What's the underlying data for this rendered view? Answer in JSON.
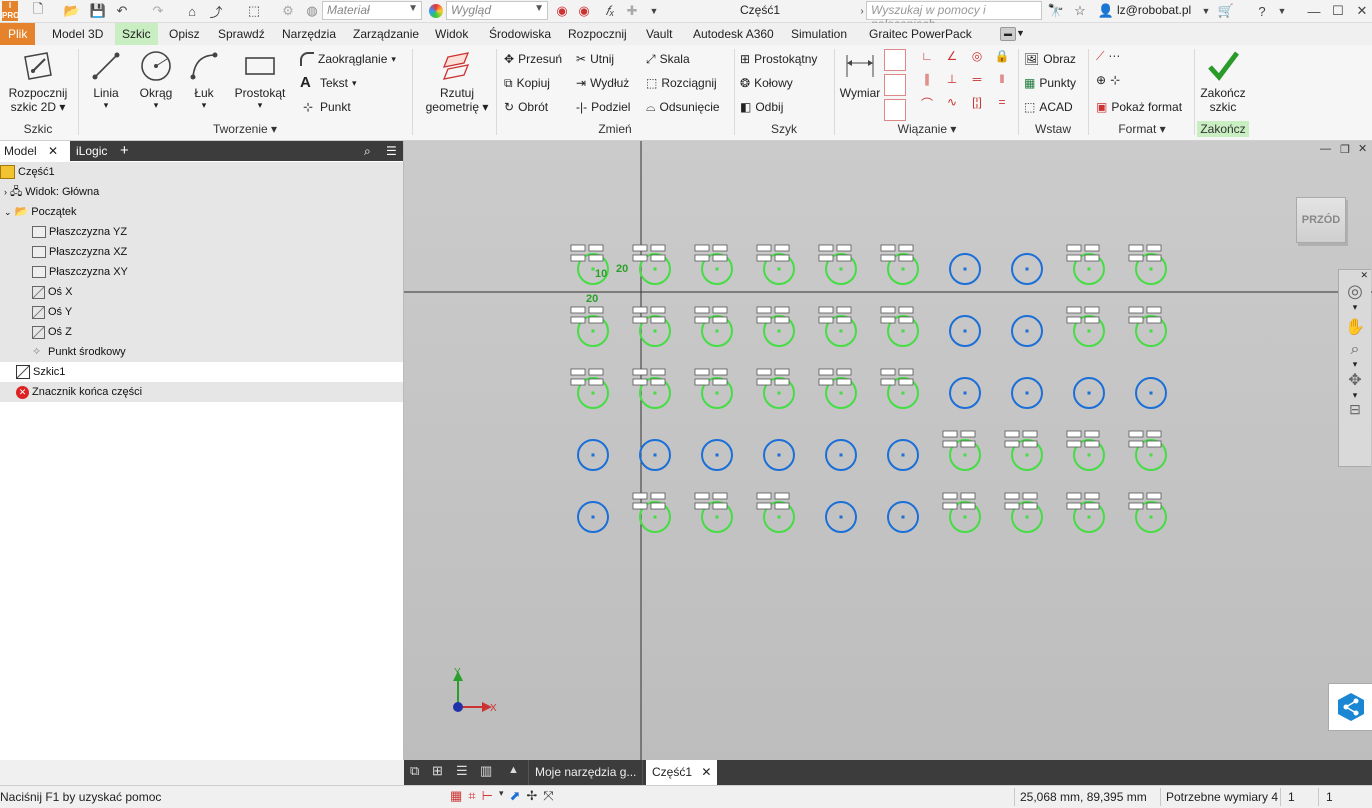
{
  "title": "Część1",
  "quick_access": {
    "material_placeholder": "Materiał",
    "appearance_placeholder": "Wygląd",
    "search_placeholder": "Wyszukaj w pomocy i poleceniach",
    "user": "lz@robobat.pl"
  },
  "menu_tabs": [
    "Plik",
    "Model 3D",
    "Szkic",
    "Opisz",
    "Sprawdź",
    "Narzędzia",
    "Zarządzanie",
    "Widok",
    "Środowiska",
    "Rozpocznij",
    "Vault",
    "Autodesk A360",
    "Simulation",
    "Graitec PowerPack"
  ],
  "active_tab": "Szkic",
  "ribbon": {
    "szkic": {
      "start": "Rozpocznij",
      "start2": "szkic 2D",
      "label": "Szkic"
    },
    "tworzenie": {
      "linia": "Linia",
      "okrag": "Okrąg",
      "luk": "Łuk",
      "prostokat": "Prostokąt",
      "zaokraglanie": "Zaokrąglanie",
      "tekst": "Tekst",
      "punkt": "Punkt",
      "label": "Tworzenie"
    },
    "rzutuj": {
      "l1": "Rzutuj",
      "l2": "geometrię"
    },
    "zmien": {
      "przesun": "Przesuń",
      "utnij": "Utnij",
      "skala": "Skala",
      "kopiuj": "Kopiuj",
      "wydluz": "Wydłuż",
      "rozciagnij": "Rozciągnij",
      "obrot": "Obrót",
      "podziel": "Podziel",
      "odsuniecie": "Odsunięcie",
      "label": "Zmień"
    },
    "szyk": {
      "prostokatny": "Prostokątny",
      "kolowy": "Kołowy",
      "odbij": "Odbij",
      "label": "Szyk"
    },
    "wiazanie": {
      "wymiar": "Wymiar",
      "label": "Wiązanie"
    },
    "wstaw": {
      "obraz": "Obraz",
      "punkty": "Punkty",
      "acad": "ACAD",
      "label": "Wstaw"
    },
    "format": {
      "pokaz": "Pokaż format",
      "label": "Format"
    },
    "zakoncz": {
      "l1": "Zakończ",
      "l2": "szkic",
      "label": "Zakończ"
    }
  },
  "browser": {
    "tabs": [
      "Model",
      "iLogic"
    ],
    "items": [
      {
        "label": "Część1",
        "indent": 0
      },
      {
        "label": "Widok: Główna",
        "indent": 1
      },
      {
        "label": "Początek",
        "indent": 1
      },
      {
        "label": "Płaszczyzna YZ",
        "indent": 2
      },
      {
        "label": "Płaszczyzna XZ",
        "indent": 2
      },
      {
        "label": "Płaszczyzna XY",
        "indent": 2
      },
      {
        "label": "Oś X",
        "indent": 2
      },
      {
        "label": "Oś Y",
        "indent": 2
      },
      {
        "label": "Oś Z",
        "indent": 2
      },
      {
        "label": "Punkt środkowy",
        "indent": 2
      },
      {
        "label": "Szkic1",
        "indent": 1
      },
      {
        "label": "Znacznik końca części",
        "indent": 1
      }
    ]
  },
  "viewcube_label": "PRZÓD",
  "dimension_labels": [
    "10",
    "20",
    "20"
  ],
  "axis_labels": {
    "x": "X",
    "y": "Y"
  },
  "doc_tabs": [
    "Moje narzędzia g...",
    "Część1"
  ],
  "status": {
    "help": "Naciśnij F1 by uzyskać pomoc",
    "coords": "25,068 mm, 89,395 mm",
    "required": "Potrzebne wymiary 4",
    "n1": "1",
    "n2": "1"
  },
  "colors": {
    "file_tab": "#e4832c",
    "active_tab": "#c8eec2",
    "constrained": "#44dd44",
    "unconstrained": "#1a6fd8"
  },
  "circle_grid": [
    [
      "g",
      "g",
      "g",
      "g",
      "g",
      "g",
      "b",
      "b",
      "g",
      "g"
    ],
    [
      "g",
      "g",
      "g",
      "g",
      "g",
      "g",
      "b",
      "b",
      "g",
      "g"
    ],
    [
      "g",
      "g",
      "g",
      "g",
      "g",
      "g",
      "b",
      "b",
      "b",
      "b"
    ],
    [
      "b",
      "b",
      "b",
      "b",
      "b",
      "b",
      "g",
      "g",
      "g",
      "g"
    ],
    [
      "b",
      "g",
      "g",
      "g",
      "b",
      "b",
      "g",
      "g",
      "g",
      "g"
    ]
  ]
}
